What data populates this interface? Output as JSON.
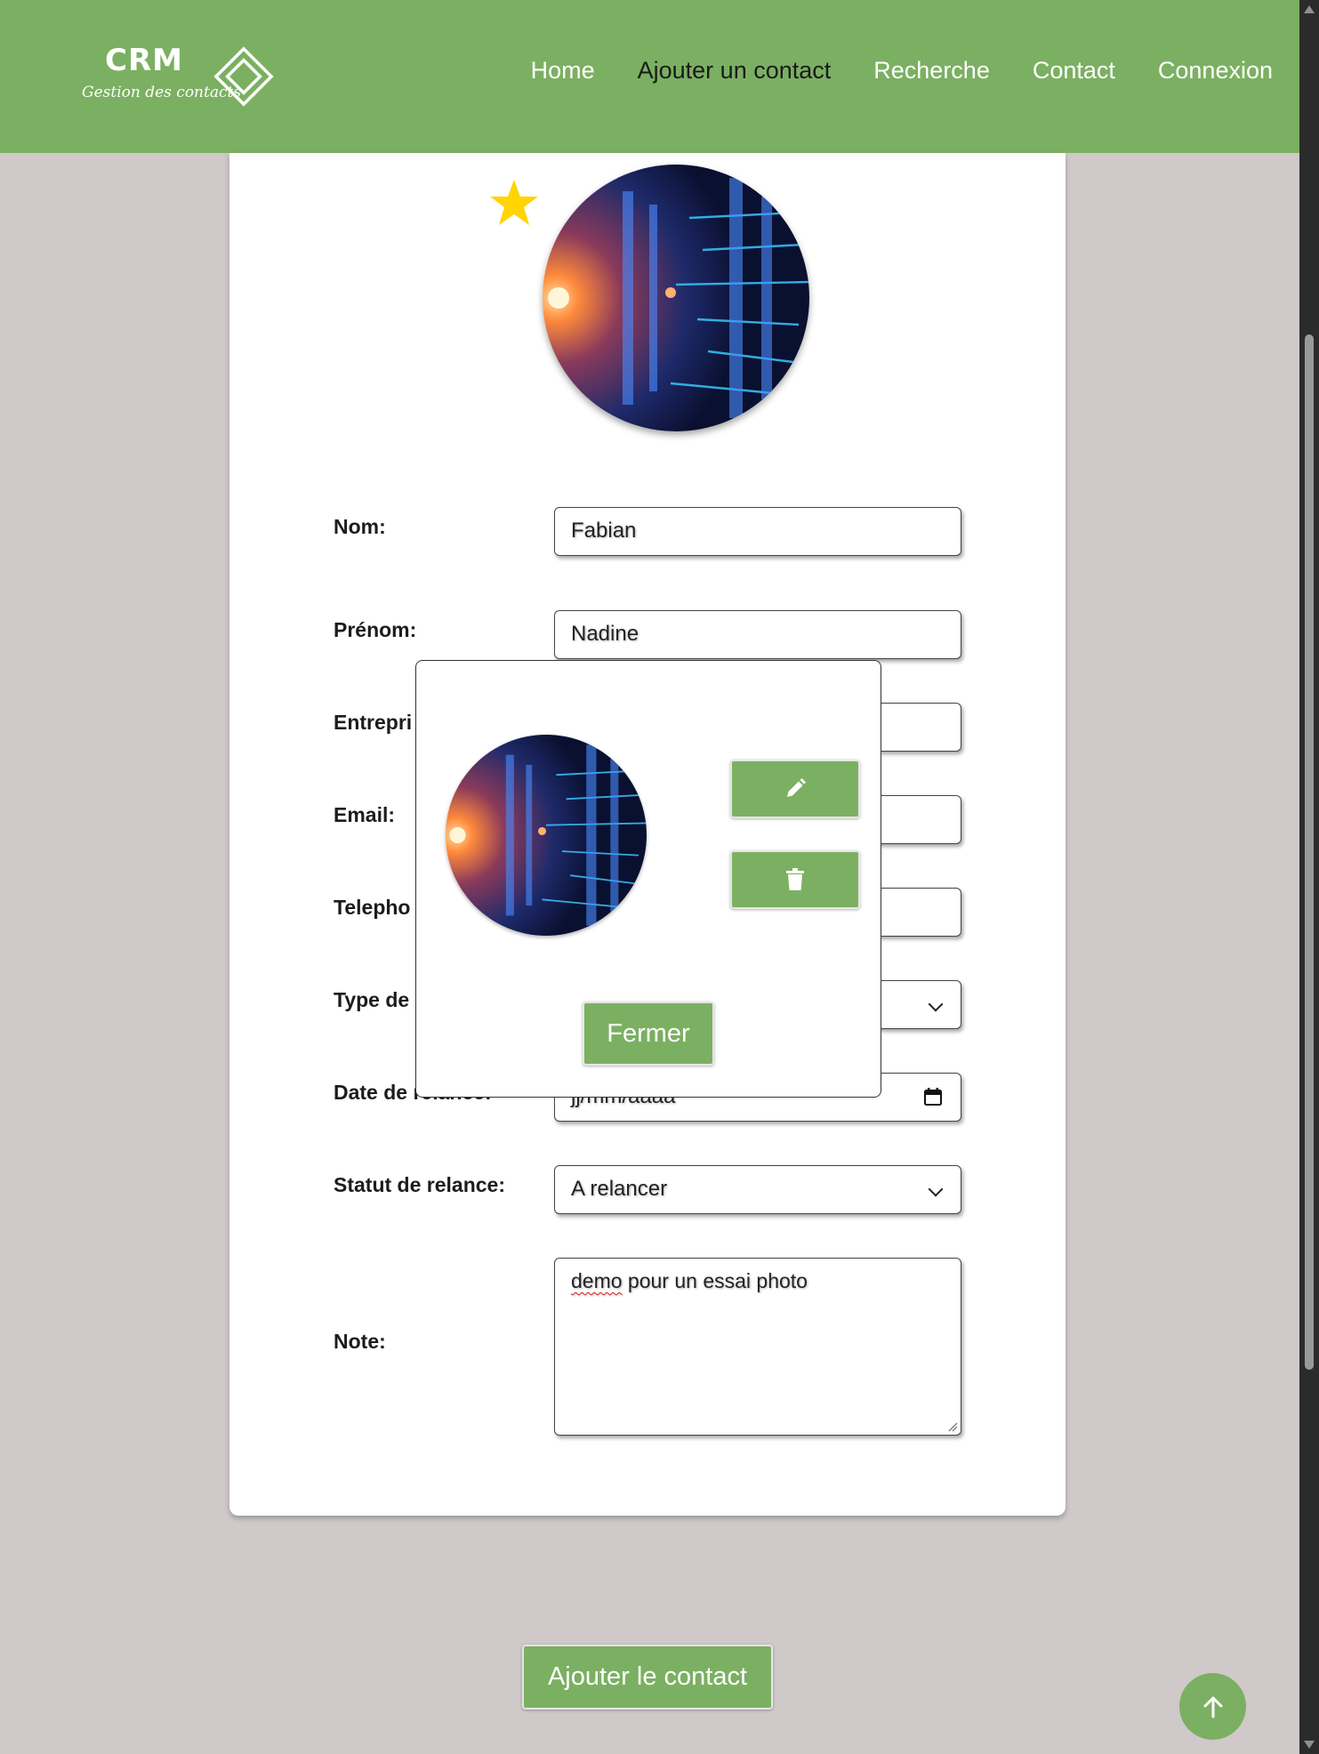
{
  "header": {
    "logo_title": "CRM",
    "logo_subtitle": "Gestion des contacts",
    "nav": [
      {
        "label": "Home"
      },
      {
        "label": "Ajouter un contact"
      },
      {
        "label": "Recherche"
      },
      {
        "label": "Contact"
      },
      {
        "label": "Connexion"
      }
    ]
  },
  "form": {
    "nom": {
      "label": "Nom:",
      "value": "Fabian"
    },
    "prenom": {
      "label": "Prénom:",
      "value": "Nadine"
    },
    "entreprise": {
      "label": "Entrepri",
      "value": ""
    },
    "email": {
      "label": "Email:",
      "value": ""
    },
    "telephone": {
      "label": "Telepho",
      "value": ""
    },
    "type": {
      "label": "Type de",
      "value": ""
    },
    "date_relance": {
      "label": "Date de relance:",
      "placeholder": "jj/mm/aaaa"
    },
    "statut_relance": {
      "label": "Statut de relance:",
      "value": "A relancer"
    },
    "note": {
      "label": "Note:",
      "value_word1": "demo",
      "value_rest": " pour un essai photo"
    }
  },
  "modal": {
    "close_label": "Fermer",
    "edit_icon": "pencil-icon",
    "delete_icon": "trash-icon"
  },
  "actions": {
    "add_contact_label": "Ajouter le contact"
  },
  "colors": {
    "accent_green": "#7bb062",
    "page_background": "#cfc9c9",
    "star_gold": "#ffd400"
  }
}
